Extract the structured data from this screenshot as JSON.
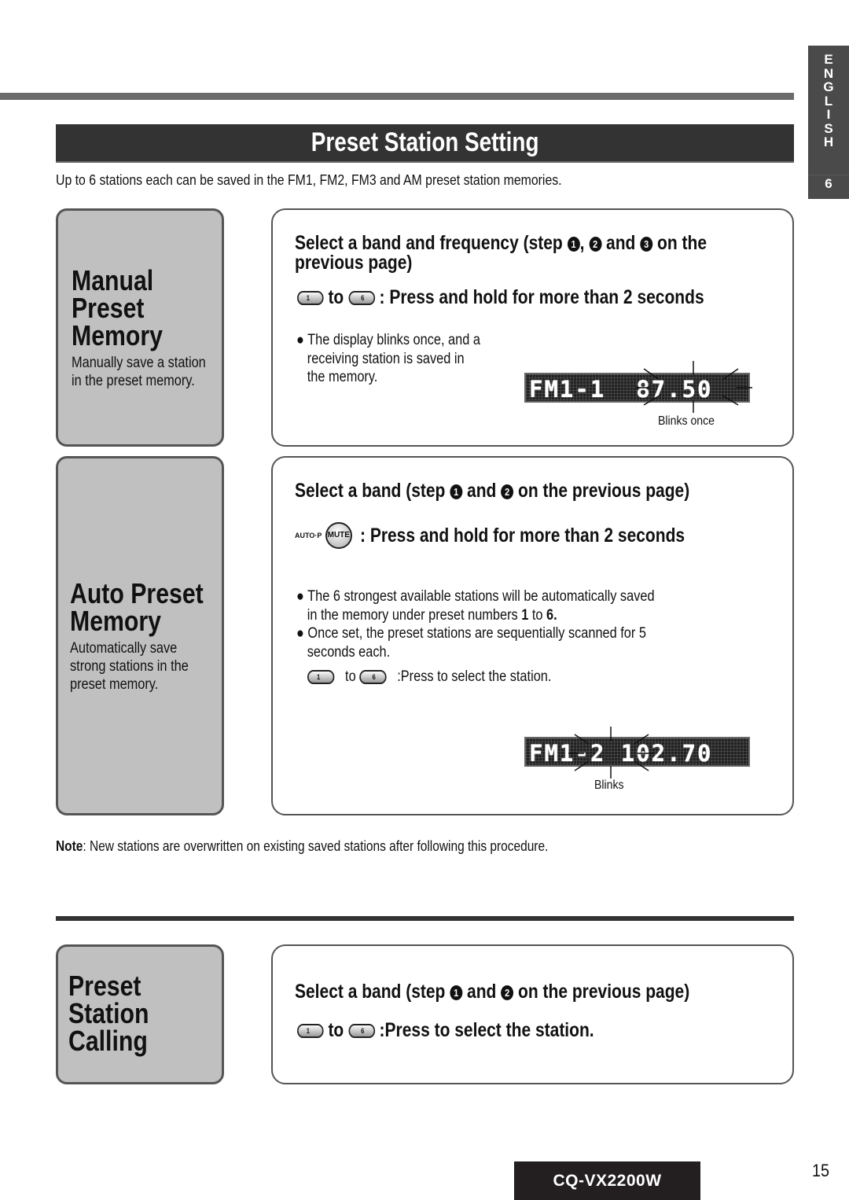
{
  "language_tab": {
    "letters": "E N G L I S H",
    "section_number": "6"
  },
  "header": {
    "title": "Preset Station Setting",
    "intro": "Up to 6 stations each can be saved in the FM1, FM2, FM3 and AM preset station memories."
  },
  "sections": [
    {
      "id": "manual",
      "title_lines": [
        "Manual",
        "Preset",
        "Memory"
      ],
      "subtitle_lines": [
        "Manually save a station",
        "in the preset memory."
      ],
      "step_line1": "Select a band and frequency (step ",
      "step_circ": [
        "1",
        "2",
        "3"
      ],
      "step_sep1": ",",
      "step_and": "and",
      "step_tail": "on the",
      "step_line2": "previous page)",
      "button_from": "1",
      "button_to_label": "to",
      "button_to": "6",
      "action": ": Press and hold for more than 2 seconds",
      "bullets": [
        [
          "The display blinks once, and a",
          "receiving station is saved in",
          "the memory."
        ]
      ],
      "display": {
        "band": "FM1",
        "preset": "1",
        "frequency": "87.50",
        "text": "FM1-1  87.50",
        "caption": "Blinks once"
      }
    },
    {
      "id": "auto",
      "title_lines": [
        "Auto Preset",
        "Memory"
      ],
      "subtitle_lines": [
        "Automatically save",
        "strong stations in the",
        "preset memory."
      ],
      "step_line1": "Select a band (step",
      "step_circ": [
        "1",
        "2"
      ],
      "step_and": "and",
      "step_tail": "on the previous page)",
      "button_small_label": "AUTO·P",
      "button_label": "MUTE",
      "action": ": Press and hold for more than 2 seconds",
      "bullets": [
        {
          "line1": "The 6 strongest available stations will be automatically saved",
          "line2_pre": "in the memory  under preset numbers ",
          "b1": "1",
          "mid": " to ",
          "b2": "6."
        },
        {
          "line1": "Once set, the preset stations are sequentially scanned for 5",
          "line2": "seconds each."
        }
      ],
      "button_from": "1",
      "button_to_label": "to",
      "button_to": "6",
      "press_action": ":Press to select the station.",
      "display": {
        "band": "FM1",
        "preset": "2",
        "frequency": "102.70",
        "text": "FM1-2 102.70",
        "caption": "Blinks"
      }
    },
    {
      "id": "calling",
      "title_lines": [
        "Preset",
        "Station",
        "Calling"
      ],
      "step_line1": "Select a band (step",
      "step_circ": [
        "1",
        "2"
      ],
      "step_and": "and",
      "step_tail": "on the previous page)",
      "button_from": "1",
      "button_to_label": "to",
      "button_to": "6",
      "action": ":Press to select the station."
    }
  ],
  "note": {
    "label": "Note",
    "text": ": New stations are overwritten on existing saved stations after following this procedure."
  },
  "footer": {
    "model": "CQ-VX2200W",
    "page_number": "15"
  }
}
